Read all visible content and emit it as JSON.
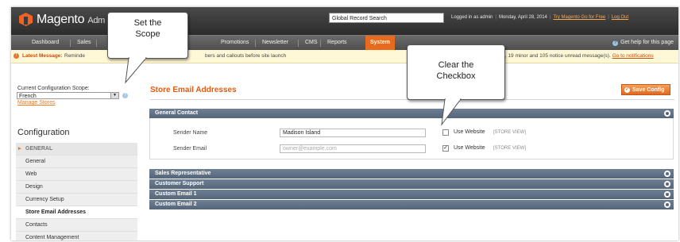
{
  "header": {
    "logo_text": "Magento",
    "logo_sub": "Adm",
    "search_value": "Global Record Search",
    "logged_in": "Logged in as admin",
    "date": "Monday, April 28, 2014",
    "try_link": "Try Magento Go for Free",
    "logout": "Log Out"
  },
  "nav": {
    "items": [
      "Dashboard",
      "Sales",
      "Promotions",
      "Newsletter",
      "CMS",
      "Reports",
      "System"
    ],
    "help": "Get help for this page"
  },
  "message": {
    "label": "Latest Message:",
    "text_start": "Reminde",
    "text_mid": "bers and callouts before site launch",
    "text_right": "r, 19 minor and 105 notice unread message(s).",
    "link": "Go to notifications"
  },
  "sidebar": {
    "scope_label": "Current Configuration Scope:",
    "scope_value": "French",
    "manage_stores": "Manage Stores",
    "config_title": "Configuration",
    "group_label": "GENERAL",
    "items": [
      "General",
      "Web",
      "Design",
      "Currency Setup",
      "Store Email Addresses",
      "Contacts",
      "Content Management"
    ]
  },
  "main": {
    "page_title": "Store Email Addresses",
    "save_button": "Save Config",
    "general_contact": {
      "title": "General Contact",
      "sender_name_label": "Sender Name",
      "sender_name_value": "Madison Island",
      "sender_email_label": "Sender Email",
      "sender_email_placeholder": "owner@example.com",
      "use_website_label": "Use Website",
      "scope_tag": "[STORE VIEW]",
      "name_use_website_checked": false,
      "email_use_website_checked": true
    },
    "collapsed_sections": [
      "Sales Representative",
      "Customer Support",
      "Custom Email 1",
      "Custom Email 2"
    ]
  },
  "callouts": {
    "scope": "Set the Scope",
    "scope_line1": "Set the",
    "scope_line2": "Scope",
    "checkbox_line1": "Clear the",
    "checkbox_line2": "Checkbox"
  },
  "colors": {
    "accent": "#e86a1f",
    "section_header": "#5e6e82",
    "header_bg": "#3b3b3b"
  }
}
